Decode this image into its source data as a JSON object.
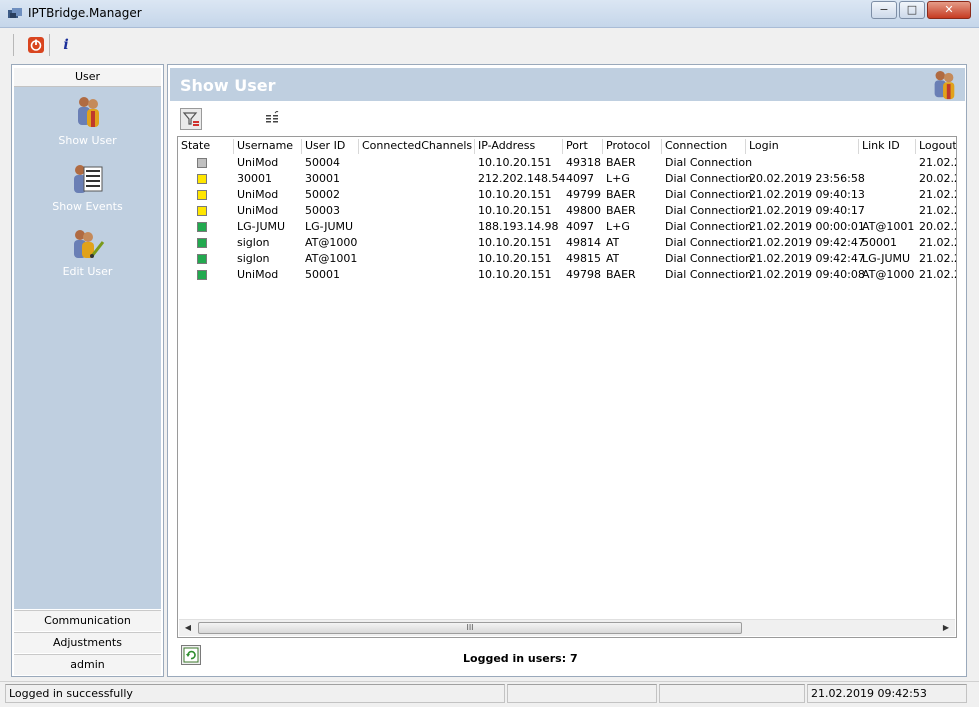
{
  "window": {
    "title": "IPTBridge.Manager",
    "controls": {
      "minimize": "−",
      "maximize": "□",
      "close": "✕"
    }
  },
  "toolbar": {
    "icons": [
      "power-icon",
      "info-icon"
    ],
    "info_glyph": "i"
  },
  "sidebar": {
    "header": "User",
    "items": [
      {
        "label": "Show User",
        "icon": "users-icon"
      },
      {
        "label": "Show Events",
        "icon": "events-icon"
      },
      {
        "label": "Edit User",
        "icon": "edit-user-icon"
      }
    ],
    "footer": [
      "Communication",
      "Adjustments",
      "admin"
    ]
  },
  "panel": {
    "title": "Show User",
    "columns": [
      "State",
      "Username",
      "User ID",
      "ConnectedChannels",
      "IP-Address",
      "Port",
      "Protocol",
      "Connection",
      "Login",
      "Link ID",
      "Logout"
    ],
    "rows": [
      {
        "state": "gray",
        "state_color": "#c0c0c0",
        "username": "UniMod",
        "userid": "50004",
        "channels": "",
        "ip": "10.10.20.151",
        "port": "49318",
        "protocol": "BAER",
        "connection": "Dial Connection",
        "login": "",
        "linkid": "",
        "logout": "21.02.2"
      },
      {
        "state": "yellow",
        "state_color": "#ffe600",
        "username": "30001",
        "userid": "30001",
        "channels": "",
        "ip": "212.202.148.54",
        "port": "4097",
        "protocol": "L+G",
        "connection": "Dial Connection",
        "login": "20.02.2019 23:56:58",
        "linkid": "",
        "logout": "20.02.2"
      },
      {
        "state": "yellow",
        "state_color": "#ffe600",
        "username": "UniMod",
        "userid": "50002",
        "channels": "",
        "ip": "10.10.20.151",
        "port": "49799",
        "protocol": "BAER",
        "connection": "Dial Connection",
        "login": "21.02.2019 09:40:13",
        "linkid": "",
        "logout": "21.02.2"
      },
      {
        "state": "yellow",
        "state_color": "#ffe600",
        "username": "UniMod",
        "userid": "50003",
        "channels": "",
        "ip": "10.10.20.151",
        "port": "49800",
        "protocol": "BAER",
        "connection": "Dial Connection",
        "login": "21.02.2019 09:40:17",
        "linkid": "",
        "logout": "21.02.2"
      },
      {
        "state": "green",
        "state_color": "#22a94f",
        "username": "LG-JUMU",
        "userid": "LG-JUMU",
        "channels": "",
        "ip": "188.193.14.98",
        "port": "4097",
        "protocol": "L+G",
        "connection": "Dial Connection",
        "login": "21.02.2019 00:00:01",
        "linkid": "AT@1001",
        "logout": "20.02.2"
      },
      {
        "state": "green",
        "state_color": "#22a94f",
        "username": "siglon",
        "userid": "AT@1000",
        "channels": "",
        "ip": "10.10.20.151",
        "port": "49814",
        "protocol": "AT",
        "connection": "Dial Connection",
        "login": "21.02.2019 09:42:47",
        "linkid": "50001",
        "logout": "21.02.2"
      },
      {
        "state": "green",
        "state_color": "#22a94f",
        "username": "siglon",
        "userid": "AT@1001",
        "channels": "",
        "ip": "10.10.20.151",
        "port": "49815",
        "protocol": "AT",
        "connection": "Dial Connection",
        "login": "21.02.2019 09:42:47",
        "linkid": "LG-JUMU",
        "logout": "21.02.2"
      },
      {
        "state": "green",
        "state_color": "#22a94f",
        "username": "UniMod",
        "userid": "50001",
        "channels": "",
        "ip": "10.10.20.151",
        "port": "49798",
        "protocol": "BAER",
        "connection": "Dial Connection",
        "login": "21.02.2019 09:40:08",
        "linkid": "AT@1000",
        "logout": "21.02.2"
      }
    ],
    "scroll_thumb_glyph": "III",
    "logged_in_label": "Logged in users: 7"
  },
  "statusbar": {
    "message": "Logged in successfully",
    "datetime": "21.02.2019 09:42:53"
  },
  "colors": {
    "sidebar_bg": "#bfcfe0",
    "title_text": "#ffffff",
    "power_icon": "#d9451f",
    "info_icon": "#1b2f9a"
  }
}
